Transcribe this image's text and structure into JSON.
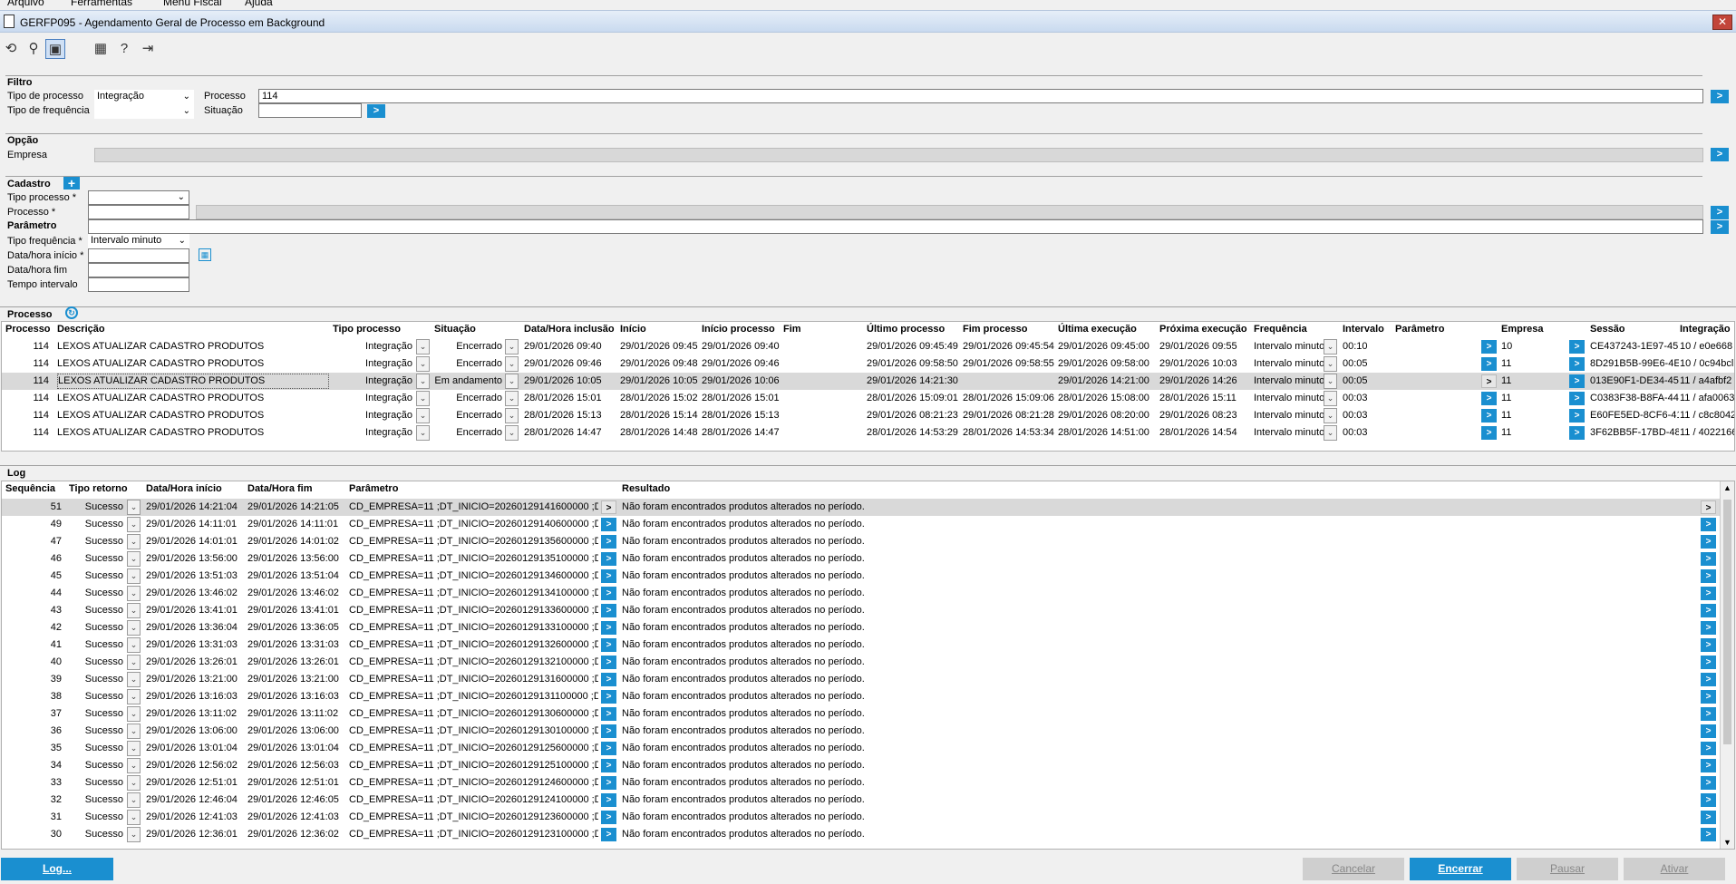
{
  "menu": [
    "Arquivo",
    "Ferramentas",
    "Menu Fiscal",
    "Ajuda"
  ],
  "window": {
    "title": "GERFP095 - Agendamento Geral de Processo em Background",
    "close": "✕"
  },
  "toolbar": [
    "refresh-icon",
    "search-icon",
    "save-icon",
    "calendar-icon",
    "help-icon",
    "exit-icon"
  ],
  "filtro": {
    "title": "Filtro",
    "tipo_processo_label": "Tipo de processo",
    "tipo_processo_value": "Integração",
    "tipo_frequencia_label": "Tipo de frequência",
    "processo_label": "Processo",
    "processo_value": "114",
    "situacao_label": "Situação",
    "go": ">"
  },
  "opcao": {
    "title": "Opção",
    "empresa_label": "Empresa"
  },
  "cadastro": {
    "title": "Cadastro",
    "add": "+",
    "tipo_processo_label": "Tipo processo *",
    "processo_label": "Processo *",
    "parametro_label": "Parâmetro",
    "tipo_frequencia_label": "Tipo frequência *",
    "tipo_frequencia_value": "Intervalo minuto",
    "data_inicio_label": "Data/hora início *",
    "data_fim_label": "Data/hora fim",
    "tempo_intervalo_label": "Tempo intervalo"
  },
  "processo_grid": {
    "title": "Processo",
    "headers": [
      "Processo",
      "Descrição",
      "Tipo processo",
      "Situação",
      "Data/Hora inclusão",
      "Início",
      "Início processo",
      "Fim",
      "Último processo",
      "Fim processo",
      "Última execução",
      "Próxima execução",
      "Frequência",
      "Intervalo",
      "Parâmetro",
      "Empresa",
      "Sessão",
      "Integração"
    ],
    "rows": [
      {
        "processo": "114",
        "descricao": "LEXOS ATUALIZAR CADASTRO PRODUTOS",
        "tipo": "Integração",
        "situacao": "Encerrado",
        "inclusao": "29/01/2026 09:40",
        "inicio": "29/01/2026 09:45",
        "inicio_proc": "29/01/2026 09:40",
        "fim": "",
        "ultimo_proc": "29/01/2026 09:45:49",
        "fim_proc": "29/01/2026 09:45:54",
        "ultima_exec": "29/01/2026 09:45:00",
        "proxima_exec": "29/01/2026 09:55",
        "frequencia": "Intervalo minuto",
        "intervalo": "00:10",
        "empresa": "10",
        "sessao": "CE437243-1E97-45",
        "integracao": "10 / e0e668"
      },
      {
        "processo": "114",
        "descricao": "LEXOS ATUALIZAR CADASTRO PRODUTOS",
        "tipo": "Integração",
        "situacao": "Encerrado",
        "inclusao": "29/01/2026 09:46",
        "inicio": "29/01/2026 09:48",
        "inicio_proc": "29/01/2026 09:46",
        "fim": "",
        "ultimo_proc": "29/01/2026 09:58:50",
        "fim_proc": "29/01/2026 09:58:55",
        "ultima_exec": "29/01/2026 09:58:00",
        "proxima_exec": "29/01/2026 10:03",
        "frequencia": "Intervalo minuto",
        "intervalo": "00:05",
        "empresa": "11",
        "sessao": "8D291B5B-99E6-4E",
        "integracao": "10 / 0c94bcl"
      },
      {
        "processo": "114",
        "descricao": "LEXOS ATUALIZAR CADASTRO PRODUTOS",
        "tipo": "Integração",
        "situacao": "Em andamento",
        "inclusao": "29/01/2026 10:05",
        "inicio": "29/01/2026 10:05",
        "inicio_proc": "29/01/2026 10:06",
        "fim": "",
        "ultimo_proc": "29/01/2026 14:21:30",
        "fim_proc": "",
        "ultima_exec": "29/01/2026 14:21:00",
        "proxima_exec": "29/01/2026 14:26",
        "frequencia": "Intervalo minuto",
        "intervalo": "00:05",
        "empresa": "11",
        "sessao": "013E90F1-DE34-45",
        "integracao": "11 / a4afbf2"
      },
      {
        "processo": "114",
        "descricao": "LEXOS ATUALIZAR CADASTRO PRODUTOS",
        "tipo": "Integração",
        "situacao": "Encerrado",
        "inclusao": "28/01/2026 15:01",
        "inicio": "28/01/2026 15:02",
        "inicio_proc": "28/01/2026 15:01",
        "fim": "",
        "ultimo_proc": "28/01/2026 15:09:01",
        "fim_proc": "28/01/2026 15:09:06",
        "ultima_exec": "28/01/2026 15:08:00",
        "proxima_exec": "28/01/2026 15:11",
        "frequencia": "Intervalo minuto",
        "intervalo": "00:03",
        "empresa": "11",
        "sessao": "C0383F38-B8FA-44",
        "integracao": "11 / afa0063"
      },
      {
        "processo": "114",
        "descricao": "LEXOS ATUALIZAR CADASTRO PRODUTOS",
        "tipo": "Integração",
        "situacao": "Encerrado",
        "inclusao": "28/01/2026 15:13",
        "inicio": "28/01/2026 15:14",
        "inicio_proc": "28/01/2026 15:13",
        "fim": "",
        "ultimo_proc": "29/01/2026 08:21:23",
        "fim_proc": "29/01/2026 08:21:28",
        "ultima_exec": "29/01/2026 08:20:00",
        "proxima_exec": "29/01/2026 08:23",
        "frequencia": "Intervalo minuto",
        "intervalo": "00:03",
        "empresa": "11",
        "sessao": "E60FE5ED-8CF6-41",
        "integracao": "11 / c8c8042"
      },
      {
        "processo": "114",
        "descricao": "LEXOS ATUALIZAR CADASTRO PRODUTOS",
        "tipo": "Integração",
        "situacao": "Encerrado",
        "inclusao": "28/01/2026 14:47",
        "inicio": "28/01/2026 14:48",
        "inicio_proc": "28/01/2026 14:47",
        "fim": "",
        "ultimo_proc": "28/01/2026 14:53:29",
        "fim_proc": "28/01/2026 14:53:34",
        "ultima_exec": "28/01/2026 14:51:00",
        "proxima_exec": "28/01/2026 14:54",
        "frequencia": "Intervalo minuto",
        "intervalo": "00:03",
        "empresa": "11",
        "sessao": "3F62BB5F-17BD-48",
        "integracao": "11 / 4022166"
      }
    ]
  },
  "log_grid": {
    "title": "Log",
    "headers": [
      "Sequência",
      "Tipo retorno",
      "Data/Hora início",
      "Data/Hora fim",
      "Parâmetro",
      "Resultado"
    ],
    "result_text": "Não foram encontrados produtos alterados no período.",
    "rows": [
      {
        "seq": "51",
        "tipo": "Sucesso",
        "inicio": "29/01/2026 14:21:04",
        "fim": "29/01/2026 14:21:05",
        "param": "CD_EMPRESA=11 ;DT_INICIO=20260129141600000 ;DS_L"
      },
      {
        "seq": "49",
        "tipo": "Sucesso",
        "inicio": "29/01/2026 14:11:01",
        "fim": "29/01/2026 14:11:01",
        "param": "CD_EMPRESA=11 ;DT_INICIO=20260129140600000 ;DS_L"
      },
      {
        "seq": "47",
        "tipo": "Sucesso",
        "inicio": "29/01/2026 14:01:01",
        "fim": "29/01/2026 14:01:02",
        "param": "CD_EMPRESA=11 ;DT_INICIO=20260129135600000 ;DS_L"
      },
      {
        "seq": "46",
        "tipo": "Sucesso",
        "inicio": "29/01/2026 13:56:00",
        "fim": "29/01/2026 13:56:00",
        "param": "CD_EMPRESA=11 ;DT_INICIO=20260129135100000 ;DS_L"
      },
      {
        "seq": "45",
        "tipo": "Sucesso",
        "inicio": "29/01/2026 13:51:03",
        "fim": "29/01/2026 13:51:04",
        "param": "CD_EMPRESA=11 ;DT_INICIO=20260129134600000 ;DS_L"
      },
      {
        "seq": "44",
        "tipo": "Sucesso",
        "inicio": "29/01/2026 13:46:02",
        "fim": "29/01/2026 13:46:02",
        "param": "CD_EMPRESA=11 ;DT_INICIO=20260129134100000 ;DS_L"
      },
      {
        "seq": "43",
        "tipo": "Sucesso",
        "inicio": "29/01/2026 13:41:01",
        "fim": "29/01/2026 13:41:01",
        "param": "CD_EMPRESA=11 ;DT_INICIO=20260129133600000 ;DS_L"
      },
      {
        "seq": "42",
        "tipo": "Sucesso",
        "inicio": "29/01/2026 13:36:04",
        "fim": "29/01/2026 13:36:05",
        "param": "CD_EMPRESA=11 ;DT_INICIO=20260129133100000 ;DS_L"
      },
      {
        "seq": "41",
        "tipo": "Sucesso",
        "inicio": "29/01/2026 13:31:03",
        "fim": "29/01/2026 13:31:03",
        "param": "CD_EMPRESA=11 ;DT_INICIO=20260129132600000 ;DS_L"
      },
      {
        "seq": "40",
        "tipo": "Sucesso",
        "inicio": "29/01/2026 13:26:01",
        "fim": "29/01/2026 13:26:01",
        "param": "CD_EMPRESA=11 ;DT_INICIO=20260129132100000 ;DS_L"
      },
      {
        "seq": "39",
        "tipo": "Sucesso",
        "inicio": "29/01/2026 13:21:00",
        "fim": "29/01/2026 13:21:00",
        "param": "CD_EMPRESA=11 ;DT_INICIO=20260129131600000 ;DS_L"
      },
      {
        "seq": "38",
        "tipo": "Sucesso",
        "inicio": "29/01/2026 13:16:03",
        "fim": "29/01/2026 13:16:03",
        "param": "CD_EMPRESA=11 ;DT_INICIO=20260129131100000 ;DS_L"
      },
      {
        "seq": "37",
        "tipo": "Sucesso",
        "inicio": "29/01/2026 13:11:02",
        "fim": "29/01/2026 13:11:02",
        "param": "CD_EMPRESA=11 ;DT_INICIO=20260129130600000 ;DS_L"
      },
      {
        "seq": "36",
        "tipo": "Sucesso",
        "inicio": "29/01/2026 13:06:00",
        "fim": "29/01/2026 13:06:00",
        "param": "CD_EMPRESA=11 ;DT_INICIO=20260129130100000 ;DS_L"
      },
      {
        "seq": "35",
        "tipo": "Sucesso",
        "inicio": "29/01/2026 13:01:04",
        "fim": "29/01/2026 13:01:04",
        "param": "CD_EMPRESA=11 ;DT_INICIO=20260129125600000 ;DS_L"
      },
      {
        "seq": "34",
        "tipo": "Sucesso",
        "inicio": "29/01/2026 12:56:02",
        "fim": "29/01/2026 12:56:03",
        "param": "CD_EMPRESA=11 ;DT_INICIO=20260129125100000 ;DS_L"
      },
      {
        "seq": "33",
        "tipo": "Sucesso",
        "inicio": "29/01/2026 12:51:01",
        "fim": "29/01/2026 12:51:01",
        "param": "CD_EMPRESA=11 ;DT_INICIO=20260129124600000 ;DS_L"
      },
      {
        "seq": "32",
        "tipo": "Sucesso",
        "inicio": "29/01/2026 12:46:04",
        "fim": "29/01/2026 12:46:05",
        "param": "CD_EMPRESA=11 ;DT_INICIO=20260129124100000 ;DS_L"
      },
      {
        "seq": "31",
        "tipo": "Sucesso",
        "inicio": "29/01/2026 12:41:03",
        "fim": "29/01/2026 12:41:03",
        "param": "CD_EMPRESA=11 ;DT_INICIO=20260129123600000 ;DS_L"
      },
      {
        "seq": "30",
        "tipo": "Sucesso",
        "inicio": "29/01/2026 12:36:01",
        "fim": "29/01/2026 12:36:02",
        "param": "CD_EMPRESA=11 ;DT_INICIO=20260129123100000 ;DS_L"
      }
    ]
  },
  "footer": {
    "log": "Log...",
    "cancelar": "Cancelar",
    "encerrar": "Encerrar",
    "pausar": "Pausar",
    "ativar": "Ativar"
  },
  "colors": {
    "accent": "#1a8fd0",
    "selected_row": "#d9d9d9",
    "disabled_button": "#cfcfcf"
  }
}
